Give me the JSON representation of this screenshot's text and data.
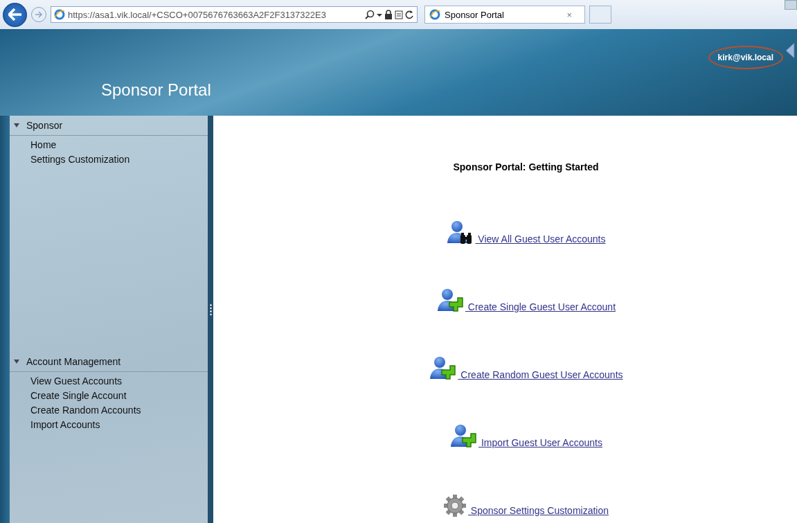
{
  "browser": {
    "address": "https://asa1.vik.local/+CSCO+0075676763663A2F2F3137322E3",
    "tabs": [
      {
        "label": "Sponsor Portal",
        "close": "×",
        "selected": true
      }
    ]
  },
  "header": {
    "title": "Sponsor Portal",
    "user": "kirk@vik.local",
    "user_circled": true
  },
  "sidebar": {
    "sections": [
      {
        "title": "Sponsor",
        "expanded": true,
        "items": [
          "Home",
          "Settings Customization"
        ]
      },
      {
        "title": "Account Management",
        "expanded": true,
        "items": [
          "View Guest Accounts",
          "Create Single Account",
          "Create Random Accounts",
          "Import Accounts"
        ]
      }
    ]
  },
  "content": {
    "title": "Sponsor Portal: Getting Started",
    "links": [
      {
        "label": "View All Guest User Accounts",
        "kind": "view"
      },
      {
        "label": "Create Single Guest User Account",
        "kind": "add"
      },
      {
        "label": "Create Random Guest User Accounts",
        "kind": "add"
      },
      {
        "label": "Import Guest User Accounts",
        "kind": "add"
      },
      {
        "label": "Sponsor Settings Customization",
        "kind": "settings"
      }
    ]
  }
}
